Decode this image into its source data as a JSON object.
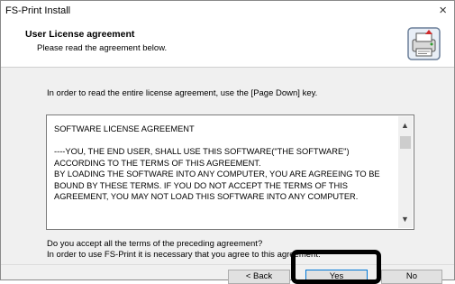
{
  "window": {
    "title": "FS-Print Install",
    "close_glyph": "×"
  },
  "header": {
    "title": "User License agreement",
    "subtitle": "Please read the agreement below.",
    "icon": "installer-icon"
  },
  "instructions": "In order to read the entire license agreement, use the [Page Down] key.",
  "license": {
    "text": "SOFTWARE LICENSE AGREEMENT\n\n----YOU, THE END USER, SHALL USE THIS SOFTWARE(\"THE SOFTWARE\") ACCORDING TO THE TERMS OF THIS AGREEMENT.\nBY LOADING THE SOFTWARE INTO ANY COMPUTER, YOU ARE AGREEING TO BE BOUND BY THESE TERMS. IF YOU DO NOT ACCEPT THE TERMS OF THIS AGREEMENT, YOU MAY NOT LOAD THIS SOFTWARE INTO ANY COMPUTER."
  },
  "question": "Do you accept all the terms of the preceding agreement?",
  "note": "In order to use FS-Print it is necessary that you agree to this agreement.",
  "buttons": {
    "back": {
      "label": "< Back"
    },
    "yes": {
      "label": "Yes"
    },
    "no": {
      "label": "No"
    }
  },
  "colors": {
    "accent": "#0078d7",
    "highlight": "#000000"
  }
}
